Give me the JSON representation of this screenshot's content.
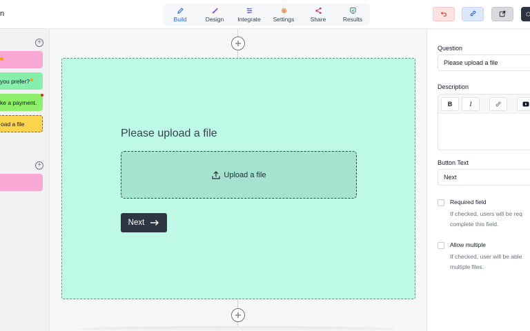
{
  "brand": {
    "fragment": "n"
  },
  "nav": [
    {
      "label": "Build",
      "icon": "pencil-icon",
      "active": true
    },
    {
      "label": "Design",
      "icon": "brush-icon",
      "active": false
    },
    {
      "label": "Integrate",
      "icon": "sliders-icon",
      "active": false
    },
    {
      "label": "Settings",
      "icon": "gear-icon",
      "active": false
    },
    {
      "label": "Share",
      "icon": "share-icon",
      "active": false
    },
    {
      "label": "Results",
      "icon": "results-icon",
      "active": false
    }
  ],
  "toolbar_buttons": [
    {
      "name": "undo-button",
      "icon": "undo-icon",
      "color": "#fde2e2"
    },
    {
      "name": "copy-link-button",
      "icon": "link-icon",
      "color": "#dde7fd"
    },
    {
      "name": "preview-button",
      "icon": "external-link-icon",
      "color": "#d9d9dd"
    },
    {
      "name": "settings-button",
      "icon": "gear-icon",
      "color": "#2b3240"
    }
  ],
  "left_panel": {
    "blocks": [
      {
        "text": "",
        "color": "#f9a8d4"
      },
      {
        "text": "you prefer?",
        "color": "#86efac"
      },
      {
        "text": "ke a payment.",
        "color": "#8ef06a"
      },
      {
        "text": "oad a file",
        "color": "#fcd34d"
      },
      {
        "text": "",
        "color": "#f9a8d4"
      }
    ]
  },
  "card": {
    "question": "Please upload a file",
    "upload_label": "Upload a file",
    "next_label": "Next",
    "background": "#bdf9e5"
  },
  "settings": {
    "question_label": "Question",
    "question_value": "Please upload a file",
    "description_label": "Description",
    "format_tools": [
      {
        "label": "B",
        "icon": "bold-icon"
      },
      {
        "label": "I",
        "icon": "italic-icon"
      },
      {
        "label": "",
        "icon": "link-icon"
      },
      {
        "label": "",
        "icon": "youtube-icon"
      }
    ],
    "button_text_label": "Button Text",
    "button_text_value": "Next",
    "required": {
      "label": "Required field",
      "help_line1": "If checked, users will be req",
      "help_line2": "complete this field.",
      "checked": false
    },
    "allow_multiple": {
      "label": "Allow multiple",
      "help_line1": "If checked, user will be able",
      "help_line2": "multiple files.",
      "checked": false
    }
  }
}
